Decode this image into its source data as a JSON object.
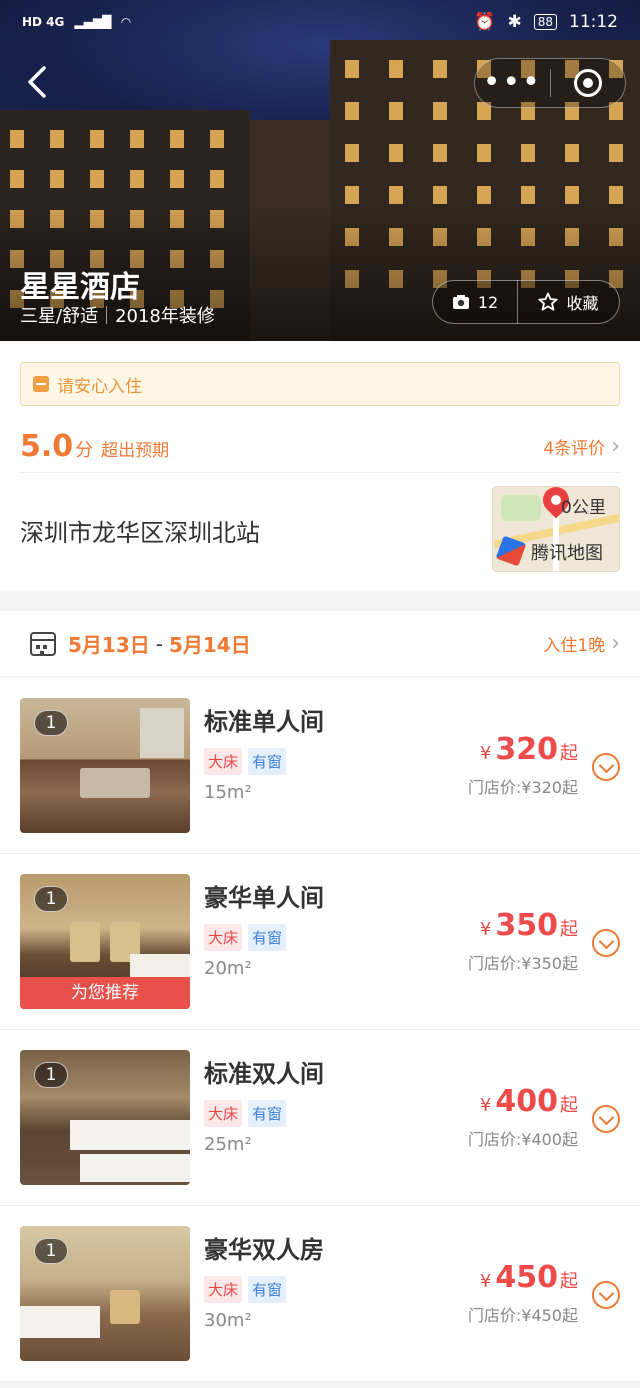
{
  "status_bar": {
    "network": "HD 4G",
    "battery": "88",
    "time": "11:12",
    "icons": [
      "hd-icon",
      "signal-icon",
      "signal-icon",
      "wifi-icon",
      "alarm-icon",
      "bluetooth-icon",
      "battery-icon"
    ]
  },
  "hero": {
    "hotel_name": "星星酒店",
    "star_level": "三星/舒适",
    "renovated": "2018年装修",
    "photo_count": "12",
    "favorite_label": "收藏"
  },
  "info": {
    "notice": "请安心入住",
    "score": "5.0",
    "score_unit": "分",
    "score_text": "超出预期",
    "reviews": "4条评价",
    "address": "深圳市龙华区深圳北站",
    "map_scale": "0公里",
    "map_label": "腾讯地图"
  },
  "dates": {
    "checkin": "5月13日",
    "separator": "-",
    "checkout": "5月14日",
    "nights": "入住1晚"
  },
  "rooms": [
    {
      "name": "标准单人间",
      "tag1": "大床",
      "tag2": "有窗",
      "size": "15m²",
      "currency": "¥",
      "price": "320",
      "suffix": "起",
      "store_price": "门店价:¥320起",
      "badge": "1",
      "recommend": ""
    },
    {
      "name": "豪华单人间",
      "tag1": "大床",
      "tag2": "有窗",
      "size": "20m²",
      "currency": "¥",
      "price": "350",
      "suffix": "起",
      "store_price": "门店价:¥350起",
      "badge": "1",
      "recommend": "为您推荐"
    },
    {
      "name": "标准双人间",
      "tag1": "大床",
      "tag2": "有窗",
      "size": "25m²",
      "currency": "¥",
      "price": "400",
      "suffix": "起",
      "store_price": "门店价:¥400起",
      "badge": "1",
      "recommend": ""
    },
    {
      "name": "豪华双人房",
      "tag1": "大床",
      "tag2": "有窗",
      "size": "30m²",
      "currency": "¥",
      "price": "450",
      "suffix": "起",
      "store_price": "门店价:¥450起",
      "badge": "1",
      "recommend": ""
    }
  ],
  "colors": {
    "accent_orange": "#f07a34",
    "price_red": "#ee4a4a",
    "recommend_red": "#e8504a"
  }
}
